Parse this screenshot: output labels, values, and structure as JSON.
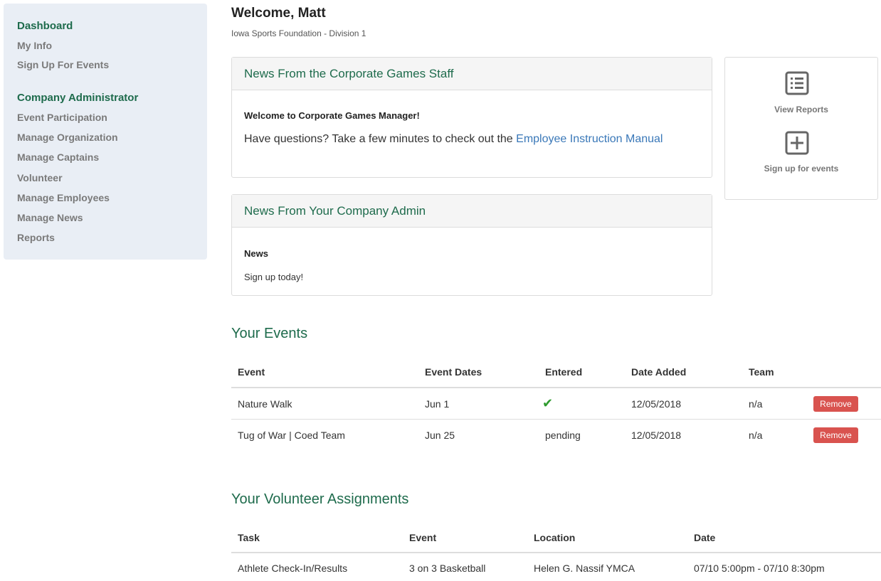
{
  "sidebar": {
    "dashboard": "Dashboard",
    "my_info": "My Info",
    "sign_up_events": "Sign Up For Events",
    "company_admin_heading": "Company Administrator",
    "admin_items": [
      "Event Participation",
      "Manage Organization",
      "Manage Captains",
      "Volunteer",
      "Manage Employees",
      "Manage News",
      "Reports"
    ]
  },
  "header": {
    "welcome": "Welcome, Matt",
    "subtitle": "Iowa Sports Foundation - Division 1"
  },
  "news_staff": {
    "title": "News From the Corporate Games Staff",
    "headline": "Welcome to Corporate Games Manager!",
    "body_prefix": "Have questions? Take a few minutes to check out the ",
    "link_text": "Employee Instruction Manual"
  },
  "news_admin": {
    "title": "News From Your Company Admin",
    "headline": "News",
    "body": "Sign up today!"
  },
  "quick_actions": {
    "view_reports": "View Reports",
    "sign_up": "Sign up for events"
  },
  "events": {
    "title": "Your Events",
    "columns": [
      "Event",
      "Event Dates",
      "Entered",
      "Date Added",
      "Team"
    ],
    "rows": [
      {
        "event": "Nature Walk",
        "dates": "Jun 1",
        "entered": "✔",
        "added": "12/05/2018",
        "team": "n/a",
        "action": "Remove"
      },
      {
        "event": "Tug of War | Coed Team",
        "dates": "Jun 25",
        "entered": "pending",
        "added": "12/05/2018",
        "team": "n/a",
        "action": "Remove"
      }
    ]
  },
  "volunteer": {
    "title": "Your Volunteer Assignments",
    "columns": [
      "Task",
      "Event",
      "Location",
      "Date"
    ],
    "rows": [
      {
        "task": "Athlete Check-In/Results",
        "event": "3 on 3 Basketball",
        "location": "Helen G. Nassif YMCA",
        "date": "07/10 5:00pm - 07/10 8:30pm"
      }
    ]
  },
  "colors": {
    "accent_green": "#1e6b4c",
    "link_blue": "#3a78b8",
    "remove_red": "#d9534f",
    "sidebar_bg": "#e9eef5"
  }
}
